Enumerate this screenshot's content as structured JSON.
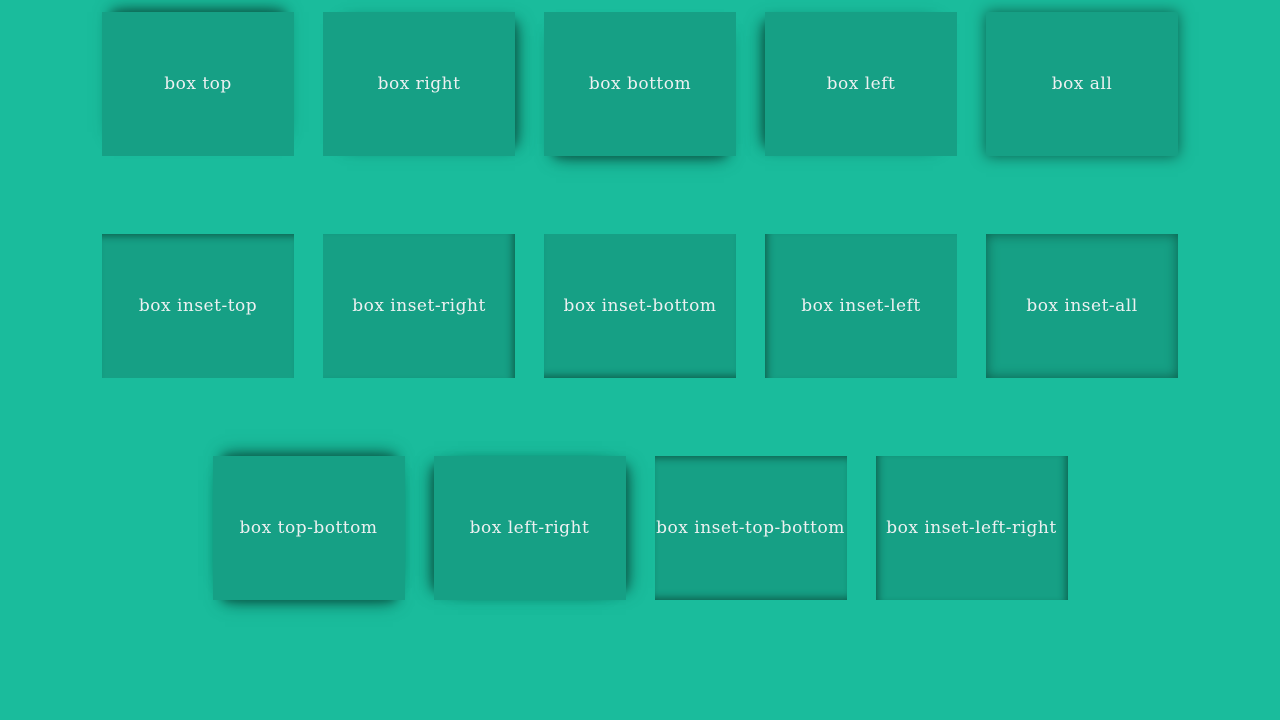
{
  "colors": {
    "background": "#1abc9c",
    "box": "#16a085",
    "text": "#ecf0f1",
    "shadow": "#0c5e4c"
  },
  "row1": {
    "box_top": "box top",
    "box_right": "box right",
    "box_bottom": "box bottom",
    "box_left": "box left",
    "box_all": "box all"
  },
  "row2": {
    "box_inset_top": "box inset-top",
    "box_inset_right": "box inset-right",
    "box_inset_bottom": "box inset-bottom",
    "box_inset_left": "box inset-left",
    "box_inset_all": "box inset-all"
  },
  "row3": {
    "box_top_bottom": "box top-bottom",
    "box_left_right": "box left-right",
    "box_inset_top_bottom": "box inset-top-bottom",
    "box_inset_left_right": "box inset-left-right"
  }
}
